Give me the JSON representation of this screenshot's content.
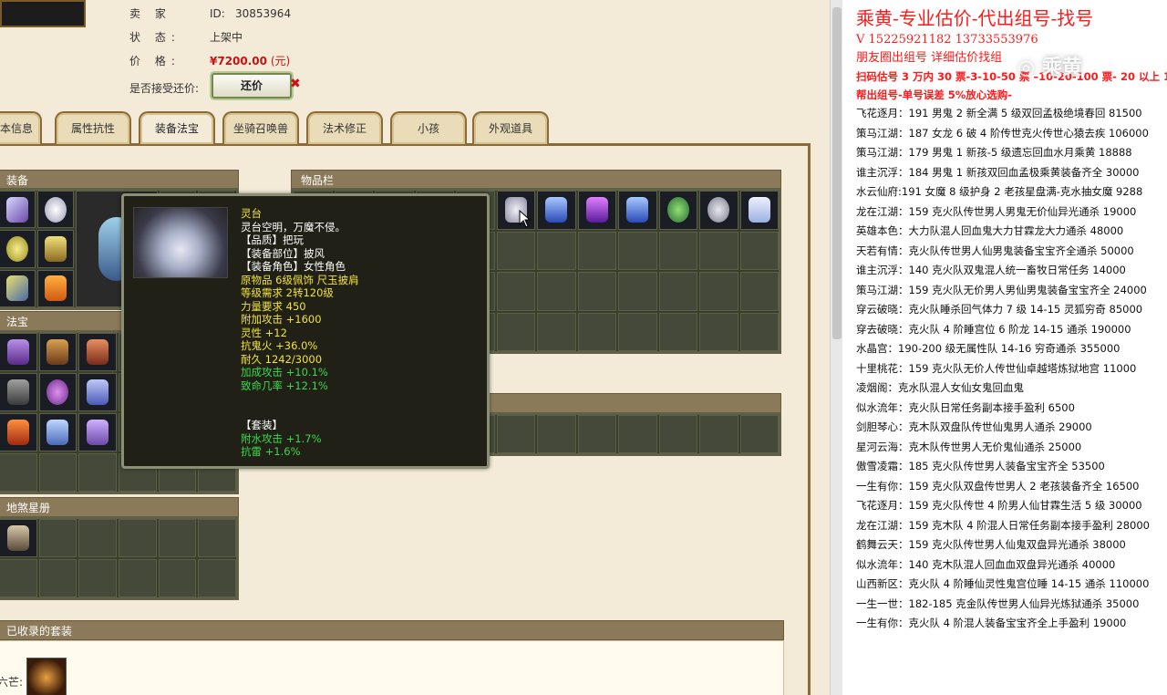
{
  "seller": {
    "label_seller": "卖 家",
    "label_status": "状 态:",
    "label_price": "价 格:",
    "label_offer": "是否接受还价:",
    "id_label": "ID:",
    "id_value": "30853964",
    "status_value": "上架中",
    "price_value": "¥7200.00",
    "price_unit": "(元)",
    "offer_button": "还价",
    "close_mark": "✖"
  },
  "tabs": [
    "本信息",
    "属性抗性",
    "装备法宝",
    "坐骑召唤兽",
    "法术修正",
    "小孩",
    "外观道具"
  ],
  "active_tab": "装备法宝",
  "sections": {
    "equip": "装备",
    "magic": "法宝",
    "inventory": "物品栏",
    "earth": "地煞星册",
    "sets": "已收录的套装",
    "sets_row_label": "六芒:"
  },
  "tooltip": {
    "name": "灵台",
    "desc": "灵台空明，万魔不侵。",
    "quality": "【品质】把玩",
    "slot": "【装备部位】披风",
    "role": "【装备角色】女性角色",
    "origin": "原物品 6级佩饰 尺玉披肩",
    "level_req": "等级需求 2转120级",
    "power_req": "力量要求 450",
    "attack": "附加攻击 +1600",
    "spirit": "灵性 +12",
    "resist_fire": "抗鬼火 +36.0%",
    "durability": "耐久 1242/3000",
    "bonus_attack": "加成攻击 +10.1%",
    "crit": "致命几率 +12.1%",
    "set_title": "【套装】",
    "set_1": "附水攻击 +1.7%",
    "set_2": "抗雷 +1.6%"
  },
  "right": {
    "title": "乘黄-专业估价-代出组号-找号",
    "phone": " V 15225921182   13733553976",
    "circle": "朋友圈出组号   详细估价找组",
    "scan_line": "扫码估号 3 万内 30 票-3-10-50 票 –10-20-100 票- 20 以上 150",
    "help_line": "帮出组号-单号误差 5%放心选购-",
    "watermark": "◎ 乘黄",
    "listings": [
      "飞花逐月：191 男鬼 2 新全满 5 级双回孟极绝境春回 81500",
      "策马江湖：187 女龙 6 破 4 阶传世克火传世心猿去疾 106000",
      "策马江湖：179 男鬼 1 新孩-5 级遗忘回血水月乘黄 18888",
      "谁主沉浮：184 男鬼 1 新孩双回血孟极乘黄装备齐全 30000",
      "水云仙府:191 女魔 8 级护身 2 老孩星盘满-克水抽女魔 9288",
      "龙在江湖：159 克火队传世男人男鬼无价仙异光通杀 19000",
      "英雄本色：大力队混人回血鬼大力甘霖龙大力通杀 48000",
      "天若有情：克火队传世男人仙男鬼装备宝宝齐全通杀 50000",
      "谁主沉浮：140 克火队双鬼混人统一畜牧日常任务 14000",
      "策马江湖：159 克火队无价男人男仙男鬼装备宝宝齐全 24000",
      "穿云破晓：克火队睡杀回气体力 7 级 14-15 灵狐穷奇 85000",
      "穿去破晓：克火队 4 阶睡宫位 6 阶龙 14-15 通杀 190000",
      "水晶宫：190-200 级无属性队 14-16 穷奇通杀 355000",
      "十里桃花：159 克火队无价人传世仙卓越塔炼狱地宫 11000",
      "凌烟阁：克水队混人女仙女鬼回血鬼",
      "似水流年：克火队日常任务副本接手盈利 6500",
      "剑胆琴心：克木队双盘队传世仙鬼男人通杀 29000",
      "星河云海：克木队传世男人无价鬼仙通杀 25000",
      "傲雪凌霜：185 克火队传世男人装备宝宝齐全 53500",
      "一生有你：159 克火队双盘传世男人 2 老孩装备齐全 16500",
      "飞花逐月：159 克火队传世 4 阶男人仙甘霖生活 5 级 30000",
      "龙在江湖：159 克木队 4 阶混人日常任务副本接手盈利 28000",
      "鹤舞云天：159 克火队传世男人仙鬼双盘异光通杀 38000",
      "似水流年：140 克木队混人回血血双盘异光通杀 40000",
      "山西新区：克火队 4 阶睡仙灵性鬼宫位睡 14-15 通杀 110000",
      "一生一世：182-185 克金队传世男人仙异光炼狱通杀 35000",
      "一生有你：克火队 4 阶混人装备宝宝齐全上手盈利 19000"
    ]
  },
  "colors": {
    "accent_red": "#ff1a1a",
    "panel_bg": "#f3ead8",
    "tooltip_yellow": "#f1e33a",
    "tooltip_green": "#3cd94a"
  }
}
